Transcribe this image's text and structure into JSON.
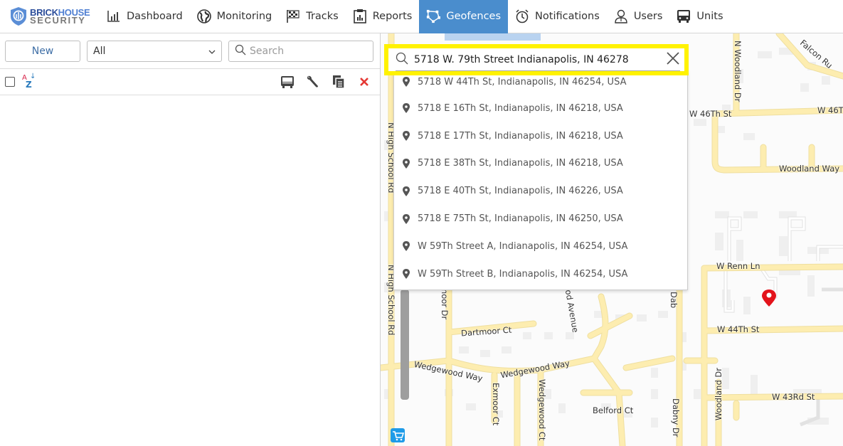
{
  "brand": {
    "line1a": "BRICK",
    "line1b": "HOUSE",
    "line2": "SECURITY"
  },
  "nav": [
    {
      "label": "Dashboard",
      "icon": "bar-chart-icon",
      "active": false
    },
    {
      "label": "Monitoring",
      "icon": "globe-icon",
      "active": false
    },
    {
      "label": "Tracks",
      "icon": "checkered-flag-icon",
      "active": false
    },
    {
      "label": "Reports",
      "icon": "clipboard-chart-icon",
      "active": false
    },
    {
      "label": "Geofences",
      "icon": "polygon-icon",
      "active": true
    },
    {
      "label": "Notifications",
      "icon": "alarm-clock-icon",
      "active": false
    },
    {
      "label": "Users",
      "icon": "user-icon",
      "active": false
    },
    {
      "label": "Units",
      "icon": "bus-icon",
      "active": false
    }
  ],
  "left_panel": {
    "new_label": "New",
    "filter_selected": "All",
    "search_placeholder": "Search"
  },
  "map_search": {
    "value": "5718 W. 79th Street Indianapolis, IN 46278",
    "highlight_color": "#fff200",
    "suggestions": [
      "5718 W 44Th St, Indianapolis, IN 46254, USA",
      "5718 E 16Th St, Indianapolis, IN 46218, USA",
      "5718 E 17Th St, Indianapolis, IN 46218, USA",
      "5718 E 38Th St, Indianapolis, IN 46218, USA",
      "5718 E 40Th St, Indianapolis, IN 46226, USA",
      "5718 E 75Th St, Indianapolis, IN 46250, USA",
      "W 59Th Street A, Indianapolis, IN 46254, USA",
      "W 59Th Street B, Indianapolis, IN 46254, USA"
    ]
  },
  "map_labels": {
    "n_woodland_dr": "N Woodland Dr",
    "falcon": "Falcon Ru",
    "w46_left": "W 46Th St",
    "w46_right": "W 46T",
    "woodland_way": "Woodland Way",
    "w_renn_ln": "W Renn Ln",
    "w44": "W 44Th St",
    "woodland_dr": "Woodland Dr",
    "w43": "W 43Rd St",
    "n_high_school_rd_1": "N High School Rd",
    "n_high_school_rd_2": "N High School Rd",
    "moor_dr": "moor Dr",
    "dartmoor_ct": "Dartmoor Ct",
    "wedgewood_way_1": "Wedgewood Way",
    "wedgewood_way_2": "Wedgewood Way",
    "exmoor_ct": "Exmoor Ct",
    "wedgewood_ct": "Wedgewood Ct",
    "od_avenue": "od Avenue",
    "belford_ct": "Belford Ct",
    "dabny_dr_top": "Dab",
    "dabny_dr": "Dabny Dr"
  },
  "colors": {
    "accent": "#4a8dcd",
    "road": "#fdedb0",
    "marker": "#e3131b",
    "delete": "#e53935"
  }
}
